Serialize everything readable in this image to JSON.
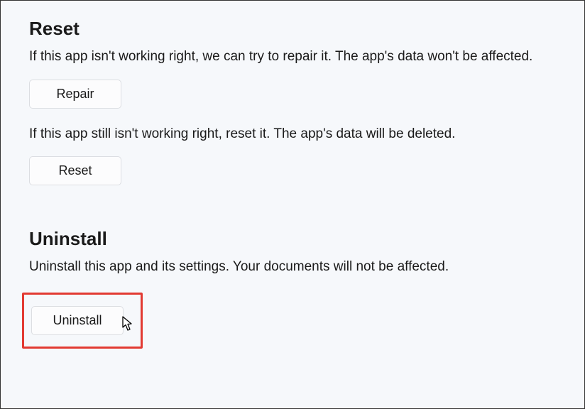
{
  "reset": {
    "heading": "Reset",
    "repair_description": "If this app isn't working right, we can try to repair it. The app's data won't be affected.",
    "repair_button": "Repair",
    "reset_description": "If this app still isn't working right, reset it. The app's data will be deleted.",
    "reset_button": "Reset"
  },
  "uninstall": {
    "heading": "Uninstall",
    "description": "Uninstall this app and its settings. Your documents will not be affected.",
    "uninstall_button": "Uninstall"
  }
}
